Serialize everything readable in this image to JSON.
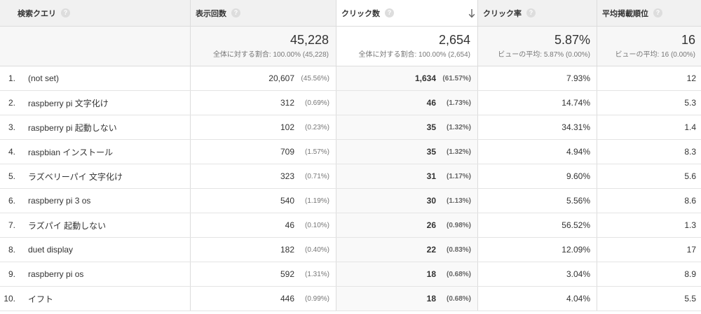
{
  "colors": {
    "text": "#333333",
    "muted": "#777777",
    "border": "#dcdcdc",
    "header_bg": "#f1f1f1",
    "sorted_header_bg": "#ffffff",
    "totals_bg": "#f7f7f7",
    "sorted_totals_bg": "#ffffff",
    "sorted_body_bg": "#f9f9f9"
  },
  "table": {
    "columns": {
      "query": {
        "label": "検索クエリ",
        "help": "?"
      },
      "impressions": {
        "label": "表示回数",
        "help": "?"
      },
      "clicks": {
        "label": "クリック数",
        "help": "?",
        "sort_icon": "arrow-down-icon"
      },
      "ctr": {
        "label": "クリック率",
        "help": "?"
      },
      "position": {
        "label": "平均掲載順位",
        "help": "?"
      }
    }
  },
  "totals": {
    "impressions": {
      "value": "45,228",
      "sub": "全体に対する割合: 100.00% (45,228)"
    },
    "clicks": {
      "value": "2,654",
      "sub": "全体に対する割合: 100.00% (2,654)"
    },
    "ctr": {
      "value": "5.87%",
      "sub": "ビューの平均: 5.87% (0.00%)"
    },
    "position": {
      "value": "16",
      "sub": "ビューの平均: 16 (0.00%)"
    }
  },
  "rows": [
    {
      "num": "1.",
      "query": "(not set)",
      "impressions": "20,607",
      "impressions_pct": "(45.56%)",
      "clicks": "1,634",
      "clicks_pct": "(61.57%)",
      "ctr": "7.93%",
      "position": "12"
    },
    {
      "num": "2.",
      "query": "raspberry pi 文字化け",
      "impressions": "312",
      "impressions_pct": "(0.69%)",
      "clicks": "46",
      "clicks_pct": "(1.73%)",
      "ctr": "14.74%",
      "position": "5.3"
    },
    {
      "num": "3.",
      "query": "raspberry pi 起動しない",
      "impressions": "102",
      "impressions_pct": "(0.23%)",
      "clicks": "35",
      "clicks_pct": "(1.32%)",
      "ctr": "34.31%",
      "position": "1.4"
    },
    {
      "num": "4.",
      "query": "raspbian インストール",
      "impressions": "709",
      "impressions_pct": "(1.57%)",
      "clicks": "35",
      "clicks_pct": "(1.32%)",
      "ctr": "4.94%",
      "position": "8.3"
    },
    {
      "num": "5.",
      "query": "ラズベリーパイ 文字化け",
      "impressions": "323",
      "impressions_pct": "(0.71%)",
      "clicks": "31",
      "clicks_pct": "(1.17%)",
      "ctr": "9.60%",
      "position": "5.6"
    },
    {
      "num": "6.",
      "query": "raspberry pi 3 os",
      "impressions": "540",
      "impressions_pct": "(1.19%)",
      "clicks": "30",
      "clicks_pct": "(1.13%)",
      "ctr": "5.56%",
      "position": "8.6"
    },
    {
      "num": "7.",
      "query": "ラズパイ 起動しない",
      "impressions": "46",
      "impressions_pct": "(0.10%)",
      "clicks": "26",
      "clicks_pct": "(0.98%)",
      "ctr": "56.52%",
      "position": "1.3"
    },
    {
      "num": "8.",
      "query": "duet display",
      "impressions": "182",
      "impressions_pct": "(0.40%)",
      "clicks": "22",
      "clicks_pct": "(0.83%)",
      "ctr": "12.09%",
      "position": "17"
    },
    {
      "num": "9.",
      "query": "raspberry pi os",
      "impressions": "592",
      "impressions_pct": "(1.31%)",
      "clicks": "18",
      "clicks_pct": "(0.68%)",
      "ctr": "3.04%",
      "position": "8.9"
    },
    {
      "num": "10.",
      "query": "イフト",
      "impressions": "446",
      "impressions_pct": "(0.99%)",
      "clicks": "18",
      "clicks_pct": "(0.68%)",
      "ctr": "4.04%",
      "position": "5.5"
    }
  ]
}
